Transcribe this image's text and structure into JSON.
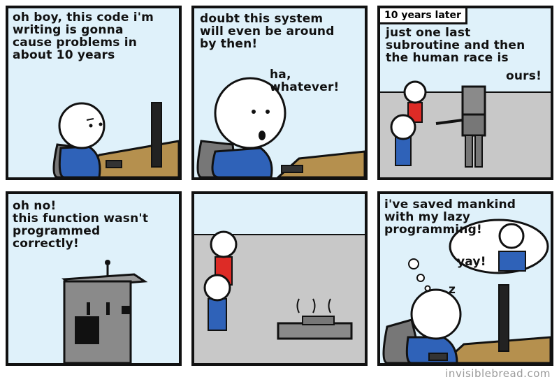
{
  "panels": [
    {
      "caption": "oh boy, this code i'm\nwriting is gonna\ncause problems in\nabout 10 years"
    },
    {
      "caption": "doubt this system\nwill even be around\nby then!",
      "aside": "ha, whatever!"
    },
    {
      "tag": "10 years later",
      "caption": "just one last\nsubroutine and then\nthe human race is",
      "aside": "ours!"
    },
    {
      "caption": "oh no!\nthis function wasn't\nprogrammed\ncorrectly!"
    },
    {
      "caption": ""
    },
    {
      "caption": "i've saved mankind\nwith my lazy\nprogramming!",
      "aside": "yay!",
      "zz": "z"
    }
  ],
  "credit": "invisiblebread.com",
  "colors": {
    "sky": "#dff1fa",
    "floor": "#c8c8c8",
    "desk": "#b5904e",
    "shirt": "#2f62b8",
    "red": "#dd2b26",
    "robot": "#8a8a8a"
  }
}
